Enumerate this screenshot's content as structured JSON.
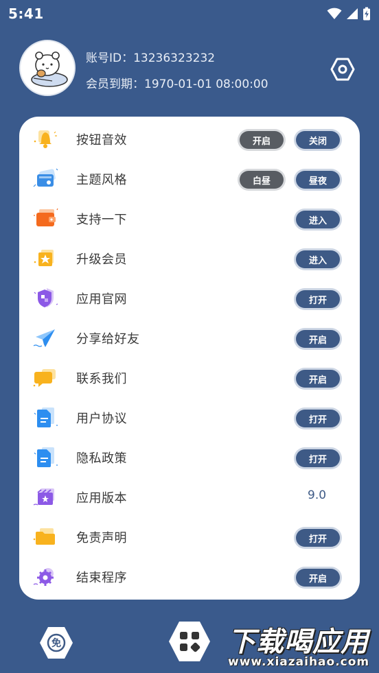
{
  "status_bar": {
    "time": "5:41"
  },
  "profile": {
    "account_id": "账号ID：13236323232",
    "vip_expire": "会员到期：1970-01-01 08:00:00"
  },
  "menu": [
    {
      "icon": "bell-icon",
      "label": "按钮音效",
      "buttons": [
        "开启",
        "关闭"
      ],
      "selected": 0
    },
    {
      "icon": "theme-card-icon",
      "label": "主题风格",
      "buttons": [
        "白昼",
        "昼夜"
      ],
      "selected": 0
    },
    {
      "icon": "wallet-icon",
      "label": "支持一下",
      "buttons": [
        "进入"
      ]
    },
    {
      "icon": "vip-star-icon",
      "label": "升级会员",
      "buttons": [
        "进入"
      ]
    },
    {
      "icon": "shield-icon",
      "label": "应用官网",
      "buttons": [
        "打开"
      ]
    },
    {
      "icon": "paper-plane-icon",
      "label": "分享给好友",
      "buttons": [
        "开启"
      ]
    },
    {
      "icon": "chat-bubble-icon",
      "label": "联系我们",
      "buttons": [
        "开启"
      ]
    },
    {
      "icon": "document-icon",
      "label": "用户协议",
      "buttons": [
        "打开"
      ]
    },
    {
      "icon": "document-icon",
      "label": "隐私政策",
      "buttons": [
        "打开"
      ]
    },
    {
      "icon": "clapperboard-icon",
      "label": "应用版本",
      "value": "9.0"
    },
    {
      "icon": "folder-icon",
      "label": "免责声明",
      "buttons": [
        "打开"
      ]
    },
    {
      "icon": "gear-icon",
      "label": "结束程序",
      "buttons": [
        "开启"
      ]
    }
  ],
  "bottom_bar": {
    "free_icon_text": "免",
    "watermark_main": "下载喝应用",
    "watermark_sub": "www.xiazaihao.com"
  },
  "colors": {
    "background": "#3a5a8c",
    "card": "#ffffff",
    "pill": "#3e5a86",
    "pill_selected": "#585c62"
  }
}
